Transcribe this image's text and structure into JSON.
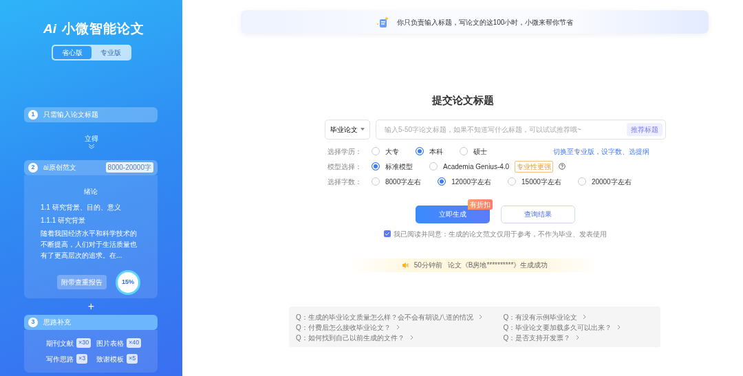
{
  "sidebar": {
    "logo": {
      "mark": "Ai",
      "title": "小微智能论文"
    },
    "edition_tabs": [
      {
        "label": "省心版",
        "selected": true
      },
      {
        "label": "专业版",
        "selected": false
      }
    ],
    "step_1": {
      "number": "1",
      "title": "只需输入论文标题"
    },
    "connector_text": "立得",
    "step_2": {
      "number": "2",
      "title": "ai原创范文",
      "badge": "8000-20000字",
      "preview": {
        "heading": "绪论",
        "lines": [
          "1.1 研究背景、目的、意义",
          "1.1.1 研究背景"
        ],
        "paragraph": "随着我国经济水平和科学技术的不断提高，人们对于生活质量也有了更高层次的追求。在..."
      },
      "report_label": "附带查重报告",
      "report_percent": "15%"
    },
    "plus_sign": "+",
    "step_3": {
      "number": "3",
      "title": "思路补充",
      "items": [
        {
          "label": "期刊文献",
          "count": "×30"
        },
        {
          "label": "图片表格",
          "count": "×40"
        },
        {
          "label": "写作思路",
          "count": "×3"
        },
        {
          "label": "致谢模板",
          "count": "×5"
        }
      ]
    }
  },
  "banner": {
    "text": "你只负责输入标题，写论文的这100小时，小微来帮你节省"
  },
  "form": {
    "title": "提交论文标题",
    "type_select": "毕业论文",
    "title_input": {
      "placeholder": "输入5-50字论文标题，如果不知道写什么标题，可以试试推荐哦~"
    },
    "recommend_button": "推荐标题",
    "option_rows": [
      {
        "label": "选择学历：",
        "options": [
          {
            "label": "大专",
            "selected": false
          },
          {
            "label": "本科",
            "selected": true
          },
          {
            "label": "硕士",
            "selected": false
          }
        ],
        "link": "切换至专业版，设字数、选提纲"
      },
      {
        "label": "模型选择：",
        "options": [
          {
            "label": "标准模型",
            "selected": true
          },
          {
            "label": "Academia Genius-4.0",
            "selected": false,
            "tag": "专业性更强",
            "help": true
          }
        ]
      },
      {
        "label": "选择字数：",
        "options": [
          {
            "label": "8000字左右",
            "selected": false
          },
          {
            "label": "12000字左右",
            "selected": true
          },
          {
            "label": "15000字左右",
            "selected": false
          },
          {
            "label": "20000字左右",
            "selected": false
          }
        ]
      }
    ],
    "generate_button": {
      "label": "立即生成",
      "badge": "有折扣"
    },
    "query_button": "查询结果",
    "agreement": {
      "checked": true,
      "text": "我已阅读并同意：生成的论文范文仅用于参考，不作为毕业、发表使用"
    }
  },
  "notice": {
    "time": "50分钟前",
    "text": "论文《B房地**********》生成成功"
  },
  "faq": [
    {
      "q": "Q：生成的毕业论文质量怎么样？会不会有胡说八道的情况"
    },
    {
      "q": "Q：有没有示例毕业论文"
    },
    {
      "q": "Q：付费后怎么接收毕业论文？"
    },
    {
      "q": "Q：毕业论文要加载多久可以出来？"
    },
    {
      "q": "Q：如何找到自己以前生成的文件？"
    },
    {
      "q": "Q：是否支持开发票？"
    }
  ]
}
